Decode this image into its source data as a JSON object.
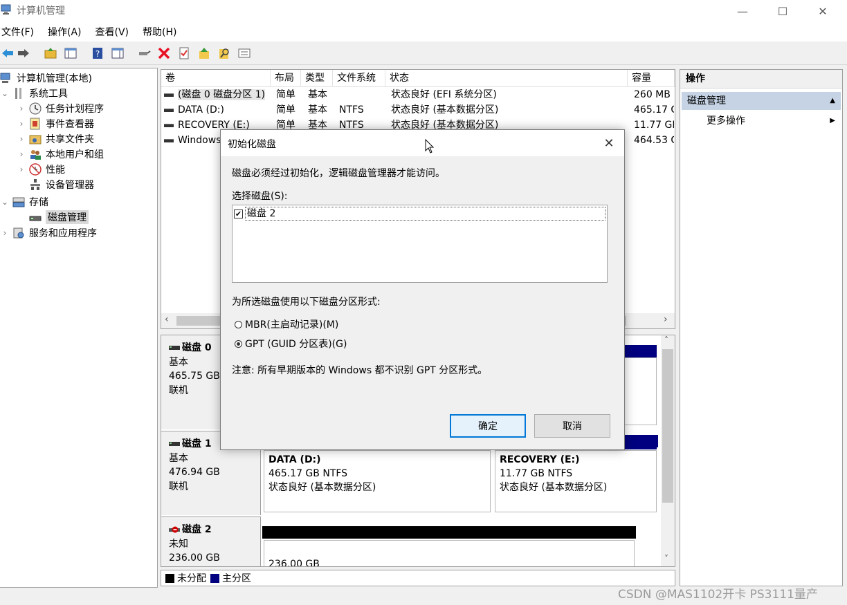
{
  "window": {
    "title": "计算机管理",
    "controls": {
      "minimize": "—",
      "maximize": "☐",
      "close": "✕"
    }
  },
  "menu": [
    "文件(F)",
    "操作(A)",
    "查看(V)",
    "帮助(H)"
  ],
  "toolbar": {
    "icons": [
      "back-icon",
      "forward-icon",
      "up-folder-icon",
      "show-tree-icon",
      "help-icon",
      "properties-icon",
      "connect-icon",
      "delete-icon",
      "check-icon",
      "folder-up-icon",
      "search-icon",
      "list-icon"
    ],
    "delete_color": "#e81123"
  },
  "tree": [
    {
      "label": "计算机管理(本地)",
      "level": 0,
      "expander": "",
      "icon": "computer-icon"
    },
    {
      "label": "系统工具",
      "level": 1,
      "expander": "⌄",
      "icon": "tools-icon"
    },
    {
      "label": "任务计划程序",
      "level": 2,
      "expander": "›",
      "icon": "clock-icon"
    },
    {
      "label": "事件查看器",
      "level": 2,
      "expander": "›",
      "icon": "event-viewer-icon"
    },
    {
      "label": "共享文件夹",
      "level": 2,
      "expander": "›",
      "icon": "shared-folder-icon"
    },
    {
      "label": "本地用户和组",
      "level": 2,
      "expander": "›",
      "icon": "users-icon"
    },
    {
      "label": "性能",
      "level": 2,
      "expander": "›",
      "icon": "performance-icon"
    },
    {
      "label": "设备管理器",
      "level": 2,
      "expander": "",
      "icon": "device-manager-icon"
    },
    {
      "label": "存储",
      "level": 1,
      "expander": "⌄",
      "icon": "storage-icon"
    },
    {
      "label": "磁盘管理",
      "level": 2,
      "expander": "",
      "icon": "disk-management-icon",
      "selected": true
    },
    {
      "label": "服务和应用程序",
      "level": 1,
      "expander": "›",
      "icon": "services-icon"
    }
  ],
  "volume_list": {
    "columns": [
      "卷",
      "布局",
      "类型",
      "文件系统",
      "状态",
      "容量"
    ],
    "rows": [
      [
        "(磁盘 0 磁盘分区 1)",
        "简单",
        "基本",
        "",
        "状态良好 (EFI 系统分区)",
        "260 MB"
      ],
      [
        "DATA (D:)",
        "简单",
        "基本",
        "NTFS",
        "状态良好 (基本数据分区)",
        "465.17 G"
      ],
      [
        "RECOVERY (E:)",
        "简单",
        "基本",
        "NTFS",
        "状态良好 (基本数据分区)",
        "11.77 GE"
      ],
      [
        "Windows",
        "",
        "",
        "",
        "",
        "464.53 G"
      ]
    ],
    "scroll_left": "‹",
    "scroll_right": "›"
  },
  "disks": [
    {
      "name": "磁盘 0",
      "type": "基本",
      "size": "465.75 GB",
      "status": "联机"
    },
    {
      "name": "磁盘 1",
      "type": "基本",
      "size": "476.94 GB",
      "status": "联机",
      "partitions": [
        {
          "title": "DATA  (D:)",
          "size": "465.17 GB NTFS",
          "status": "状态良好 (基本数据分区)"
        },
        {
          "title": "RECOVERY  (E:)",
          "size": "11.77 GB NTFS",
          "status": "状态良好 (基本数据分区)"
        }
      ]
    },
    {
      "name": "磁盘 2",
      "type": "未知",
      "size": "236.00 GB",
      "status": "",
      "partitions": [
        {
          "title": "",
          "size": "236.00 GB",
          "status": ""
        }
      ]
    }
  ],
  "disk_scroll": {
    "up": "˄",
    "down": "˅"
  },
  "legend": [
    {
      "label": "未分配",
      "color": "#000000"
    },
    {
      "label": "主分区",
      "color": "#000080"
    }
  ],
  "actions": {
    "header": "操作",
    "section": "磁盘管理",
    "collapse": "▲",
    "more": "更多操作",
    "more_arrow": "▶"
  },
  "dialog": {
    "title": "初始化磁盘",
    "close": "✕",
    "description": "磁盘必须经过初始化，逻辑磁盘管理器才能访问。",
    "select_label": "选择磁盘(S):",
    "disks": [
      {
        "label": "磁盘 2",
        "checked": true
      }
    ],
    "style_label": "为所选磁盘使用以下磁盘分区形式:",
    "options": [
      {
        "label": "MBR(主启动记录)(M)",
        "selected": false
      },
      {
        "label": "GPT (GUID 分区表)(G)",
        "selected": true
      }
    ],
    "note": "注意: 所有早期版本的 Windows 都不识别 GPT 分区形式。",
    "ok": "确定",
    "cancel": "取消"
  },
  "colors": {
    "primary_partition": "#000080",
    "unallocated": "#000000",
    "accent": "#0078d7",
    "action_section": "#c5d3e4"
  },
  "watermark": "CSDN @MAS1102开卡 PS3111量产"
}
